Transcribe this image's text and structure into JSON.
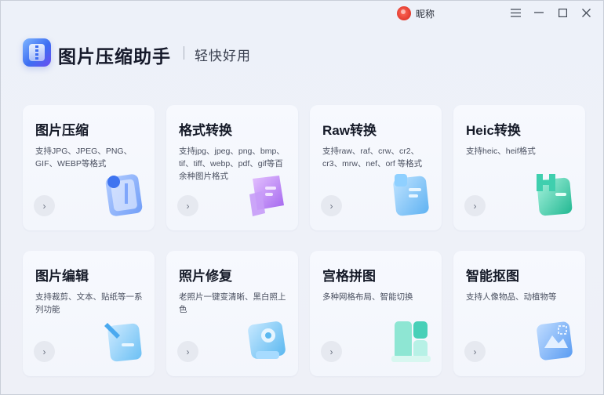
{
  "titlebar": {
    "user_name": "昵称",
    "icons": {
      "avatar": "red-flower-avatar",
      "menu": "hamburger-icon",
      "minimize": "minimize-icon",
      "maximize": "maximize-icon",
      "close": "close-icon"
    }
  },
  "header": {
    "title": "图片压缩助手",
    "subtitle": "轻快好用"
  },
  "cards": [
    {
      "title": "图片压缩",
      "desc": "支持JPG、JPEG、PNG、GIF、WEBP等格式",
      "icon": "compress-icon",
      "color": "#5b8ff7"
    },
    {
      "title": "格式转换",
      "desc": "支持jpg、jpeg、png、bmp、tif、tiff、webp、pdf、gif等百余种图片格式",
      "icon": "convert-icon",
      "color": "#b77ef0"
    },
    {
      "title": "Raw转换",
      "desc": "支持raw、raf、crw、cr2、cr3、mrw、nef、orf 等格式",
      "icon": "raw-icon",
      "color": "#5fb2f2"
    },
    {
      "title": "Heic转换",
      "desc": "支持heic、heif格式",
      "icon": "heic-icon",
      "color": "#3fcfae"
    },
    {
      "title": "图片编辑",
      "desc": "支持裁剪、文本、贴纸等一系列功能",
      "icon": "edit-icon",
      "color": "#6cc0f4"
    },
    {
      "title": "照片修复",
      "desc": "老照片一键变清晰、黑白照上色",
      "icon": "repair-icon",
      "color": "#5bb8f0"
    },
    {
      "title": "宫格拼图",
      "desc": "多种网格布局、智能切换",
      "icon": "grid-icon",
      "color": "#48d0b8"
    },
    {
      "title": "智能抠图",
      "desc": "支持人像物品、动植物等",
      "icon": "cutout-icon",
      "color": "#5a9cf2"
    }
  ],
  "go_glyph": "›"
}
